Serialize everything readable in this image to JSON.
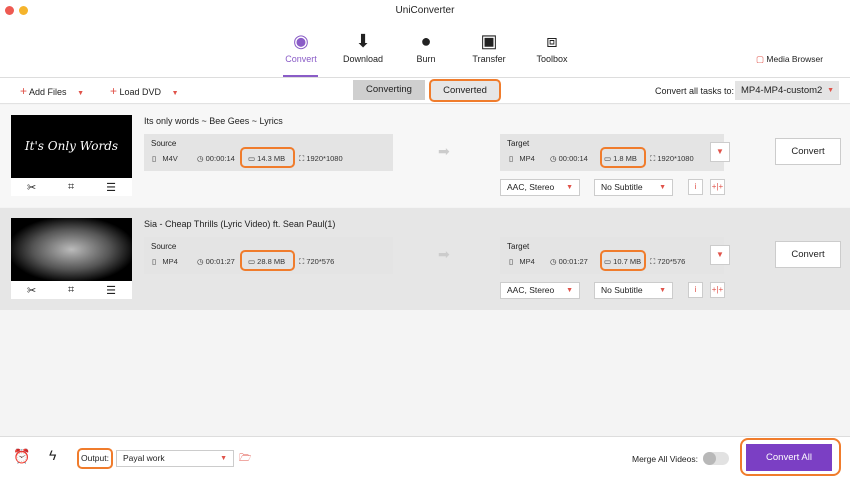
{
  "app": {
    "title": "UniConverter"
  },
  "nav": {
    "items": [
      {
        "label": "Convert",
        "icon": "convert-icon"
      },
      {
        "label": "Download",
        "icon": "download-icon"
      },
      {
        "label": "Burn",
        "icon": "burn-icon"
      },
      {
        "label": "Transfer",
        "icon": "transfer-icon"
      },
      {
        "label": "Toolbox",
        "icon": "toolbox-icon"
      }
    ],
    "active": "Convert",
    "media_browser": "Media Browser"
  },
  "toolbar": {
    "add_files": "Add Files",
    "load_dvd": "Load DVD",
    "tabs": [
      "Converting",
      "Converted"
    ],
    "convert_all_label": "Convert all tasks to:",
    "convert_all_value": "MP4-MP4-custom2"
  },
  "items": [
    {
      "title": "Its only words ~ Bee Gees ~ Lyrics",
      "thumb_text": "It's Only Words",
      "source": {
        "label": "Source",
        "format": "M4V",
        "duration": "00:00:14",
        "size": "14.3 MB",
        "resolution": "1920*1080"
      },
      "target": {
        "label": "Target",
        "format": "MP4",
        "duration": "00:00:14",
        "size": "1.8 MB",
        "resolution": "1920*1080"
      },
      "audio": "AAC, Stereo",
      "subtitle": "No Subtitle",
      "convert": "Convert"
    },
    {
      "title": "Sia - Cheap Thrills (Lyric Video) ft. Sean Paul(1)",
      "thumb_text": "",
      "source": {
        "label": "Source",
        "format": "MP4",
        "duration": "00:01:27",
        "size": "28.8 MB",
        "resolution": "720*576"
      },
      "target": {
        "label": "Target",
        "format": "MP4",
        "duration": "00:01:27",
        "size": "10.7 MB",
        "resolution": "720*576"
      },
      "audio": "AAC, Stereo",
      "subtitle": "No Subtitle",
      "convert": "Convert"
    }
  ],
  "bottom": {
    "output_label": "Output:",
    "output_value": "Payal work",
    "merge_label": "Merge All Videos:",
    "merge_on": false,
    "convert_all": "Convert All"
  },
  "colors": {
    "accent": "#7b3fc4",
    "highlight": "#f07c2c",
    "caret": "#e0534a"
  }
}
